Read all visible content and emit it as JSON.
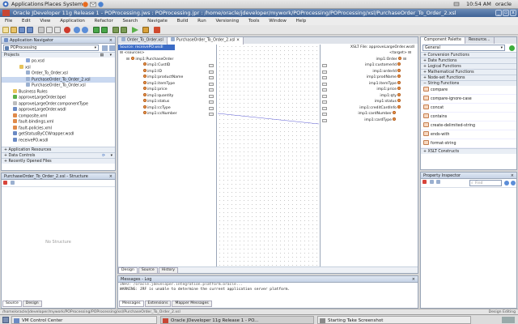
{
  "gnome_panel": {
    "menus": [
      "Applications",
      "Places",
      "System"
    ],
    "clock": "10:54 AM",
    "user": "oracle"
  },
  "window": {
    "title": "Oracle JDeveloper 11g Release 1 - POProcessing.jws : POProcessing.jpr : /home/oracle/jdeveloper/mywork/POProcessing/POProcessing/xsl/PurchaseOrder_To_Order_2.xsl"
  },
  "menubar": [
    "File",
    "Edit",
    "View",
    "Application",
    "Refactor",
    "Search",
    "Navigate",
    "Build",
    "Run",
    "Versioning",
    "Tools",
    "Window",
    "Help"
  ],
  "app_navigator": {
    "header": "Application Navigator",
    "app_select": "POProcessing",
    "projects_label": "Projects",
    "tree": [
      {
        "label": "po.xsd",
        "level": 3,
        "icon": "xsd"
      },
      {
        "label": "xsl",
        "level": 2,
        "icon": "folder"
      },
      {
        "label": "Order_To_Order.xsl",
        "level": 3,
        "icon": "xsl"
      },
      {
        "label": "PurchaseOrder_To_Order_2.xsl",
        "level": 3,
        "icon": "xsl",
        "selected": true
      },
      {
        "label": "PurchaseOrder_To_Order.xsl",
        "level": 3,
        "icon": "xsl"
      },
      {
        "label": "Business Rules",
        "level": 1,
        "icon": "folder"
      },
      {
        "label": "approveLargeOrder.bpel",
        "level": 1,
        "icon": "bpel"
      },
      {
        "label": "approveLargeOrder.componentType",
        "level": 1,
        "icon": "file"
      },
      {
        "label": "approveLargeOrder.wsdl",
        "level": 1,
        "icon": "wsdl"
      },
      {
        "label": "composite.xml",
        "level": 1,
        "icon": "xml"
      },
      {
        "label": "fault-bindings.xml",
        "level": 1,
        "icon": "xml"
      },
      {
        "label": "fault-policies.xml",
        "level": 1,
        "icon": "xml"
      },
      {
        "label": "getStatusByCCWrapper.wsdl",
        "level": 1,
        "icon": "wsdl"
      },
      {
        "label": "receivePO.wsdl",
        "level": 1,
        "icon": "wsdl"
      }
    ],
    "sections": [
      "Application Resources",
      "Data Controls",
      "Recently Opened Files"
    ]
  },
  "structure": {
    "header": "PurchaseOrder_To_Order_2.xsl - Structure",
    "empty_text": "No Structure",
    "tabs": [
      "Source",
      "Design"
    ]
  },
  "editor": {
    "tabs": [
      "Order_To_Order.xsl",
      "PurchaseOrder_To_Order_2.xsl"
    ],
    "source_label": "Source: receivePO.wsdl",
    "target_label": "XSLT File: approveLargeOrder.wsdl",
    "source_root": "<sources>",
    "source_parent": "imp1:PurchaseOrder",
    "source_fields": [
      "imp1:CustID",
      "imp1:ID",
      "imp1:productName",
      "imp1:itemType",
      "imp1:price",
      "imp1:quantity",
      "imp1:status",
      "imp1:ccType",
      "imp1:ccNumber"
    ],
    "target_root": "<target>",
    "target_parent": "imp1:Order",
    "target_fields": [
      "imp1:customerId",
      "imp1:orderId",
      "imp1:prodName",
      "imp1:itemType",
      "imp1:price",
      "imp1:qty",
      "imp1:status",
      "imp1:creditCardInfo",
      "imp1:cardNumber",
      "imp1:cardType"
    ],
    "bottom_tabs": [
      "Design",
      "Source",
      "History"
    ]
  },
  "component_palette": {
    "header": "Component Palette",
    "header2": "Resource...",
    "category": "General",
    "groups": [
      "Conversion Functions",
      "Date Functions",
      "Logical Functions",
      "Mathematical Functions",
      "Node-set Functions",
      "String Functions"
    ],
    "items": [
      "compare",
      "compare-ignore-case",
      "concat",
      "contains",
      "create-delimited-string",
      "ends-with",
      "format-string"
    ],
    "footer_group": "XSLT Constructs"
  },
  "property_inspector": {
    "header": "Property Inspector",
    "find_placeholder": "Find"
  },
  "messages": {
    "header": "Messages - Log",
    "lines": [
      "INFO: /oracle.jdeveloper.integration.platform.oracle...",
      "WARNING: JRF is unable to determine the current application server platform."
    ],
    "tabs": [
      "Messages",
      "Extensions",
      "Mapper Messages"
    ]
  },
  "statusbar": {
    "path": "/home/oracle/jdeveloper/mywork/POProcessing/POProcessing/xsl/PurchaseOrder_To_Order_2.xsl",
    "mode": "Design Editing"
  },
  "taskbar": {
    "items": [
      "VM Control Center",
      "Oracle JDeveloper 11g Release 1 - PO...",
      "Starting Take Screenshot"
    ]
  },
  "colors": {
    "title_blue": "#3f6396",
    "selection": "#3b6bc5",
    "link_line": "#5b5bd6",
    "node_orange": "#f0a25a"
  }
}
